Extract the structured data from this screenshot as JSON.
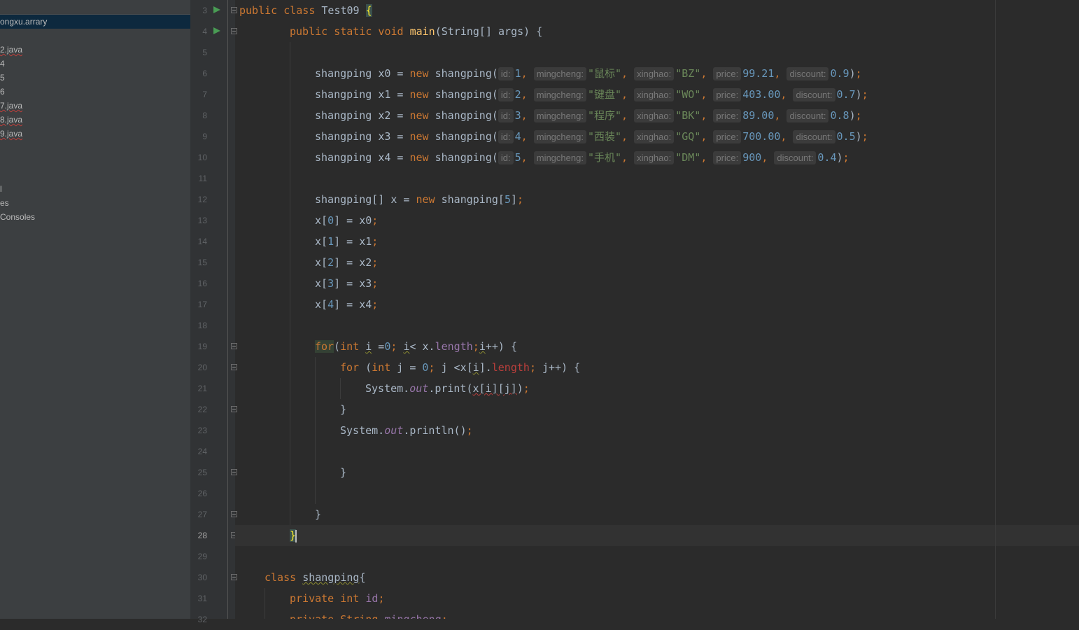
{
  "project_tree": {
    "items": [
      {
        "label": "ongxu.arrary",
        "selected": true
      },
      {
        "label": "2.java",
        "error": true
      },
      {
        "label": "4"
      },
      {
        "label": "5"
      },
      {
        "label": "6"
      },
      {
        "label": "7.java",
        "error": true
      },
      {
        "label": "8.java",
        "error": true
      },
      {
        "label": "9.java",
        "error": true
      },
      {
        "label": "l"
      },
      {
        "label": "es"
      },
      {
        "label": "Consoles"
      }
    ]
  },
  "editor": {
    "current_line": "28",
    "line_numbers": [
      "3",
      "4",
      "5",
      "6",
      "7",
      "8",
      "9",
      "10",
      "11",
      "12",
      "13",
      "14",
      "15",
      "16",
      "17",
      "18",
      "19",
      "20",
      "21",
      "22",
      "23",
      "24",
      "25",
      "26",
      "27",
      "28",
      "29",
      "30",
      "31",
      "32"
    ],
    "class_decl": {
      "kw_public": "public",
      "kw_class": "class",
      "name": "Test09",
      "brace": "{"
    },
    "main_decl": {
      "text_mods": "public static void",
      "name": "main",
      "params": "(String[] args) {"
    },
    "param_hints": {
      "id": "id:",
      "mingcheng": "mingcheng:",
      "xinghao": "xinghao:",
      "price": "price:",
      "discount": "discount:"
    },
    "products": [
      {
        "var": "x0",
        "id": "1",
        "mingcheng": "\"鼠标\"",
        "xinghao": "\"BZ\"",
        "price": "99.21",
        "discount": "0.9"
      },
      {
        "var": "x1",
        "id": "2",
        "mingcheng": "\"键盘\"",
        "xinghao": "\"WO\"",
        "price": "403.00",
        "discount": "0.7"
      },
      {
        "var": "x2",
        "id": "3",
        "mingcheng": "\"程序\"",
        "xinghao": "\"BK\"",
        "price": "89.00",
        "discount": "0.8"
      },
      {
        "var": "x3",
        "id": "4",
        "mingcheng": "\"西装\"",
        "xinghao": "\"GQ\"",
        "price": "700.00",
        "discount": "0.5"
      },
      {
        "var": "x4",
        "id": "5",
        "mingcheng": "\"手机\"",
        "xinghao": "\"DM\"",
        "price": "900",
        "discount": "0.4"
      }
    ],
    "array_decl": {
      "type": "shangping[] x = ",
      "kw_new": "new",
      "ctor": " shangping[",
      "size": "5",
      "end": "]"
    },
    "assignments": [
      {
        "index": "0",
        "value": "x0"
      },
      {
        "index": "1",
        "value": "x1"
      },
      {
        "index": "2",
        "value": "x2"
      },
      {
        "index": "3",
        "value": "x3"
      },
      {
        "index": "4",
        "value": "x4"
      }
    ],
    "inner_class": {
      "kw": "class",
      "name": "shangping",
      "brace": "{"
    },
    "field_line": {
      "kw": "private int",
      "name": "id"
    },
    "field_line2": {
      "kw": "private String",
      "name": "mingcheng"
    }
  }
}
